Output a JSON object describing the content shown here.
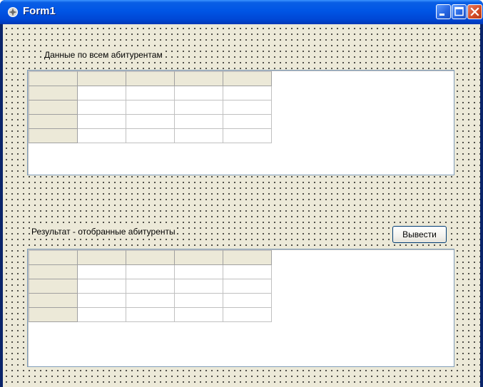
{
  "window": {
    "title": "Form1"
  },
  "form": {
    "top_label": "Данные по всем абитурентам",
    "bottom_label": "Результат - отобранные абитуренты",
    "output_button": "Вывести"
  },
  "grids": {
    "rows": 5,
    "columns": 5
  },
  "colors": {
    "titlebar": "#0055e5",
    "client_background": "#ece9d8",
    "grid_border": "#7f9db9",
    "close_button": "#d24a25"
  }
}
